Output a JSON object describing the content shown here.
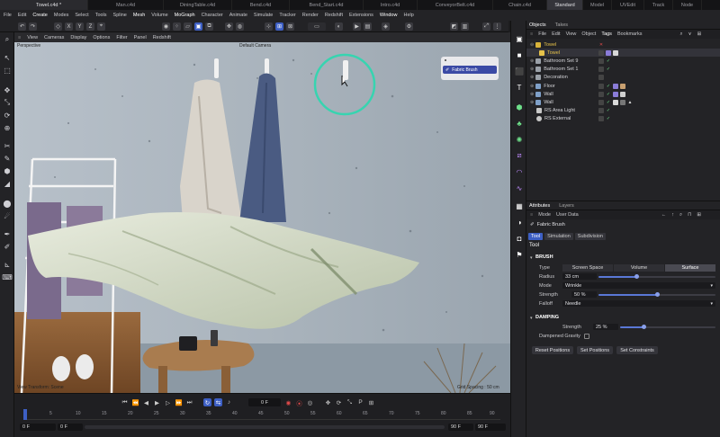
{
  "tabs": [
    {
      "label": "Towel.c4d *",
      "active": true
    },
    {
      "label": "Man.c4d"
    },
    {
      "label": "DiningTable.c4d"
    },
    {
      "label": "Bend.c4d"
    },
    {
      "label": "Bend_Start.c4d"
    },
    {
      "label": "Intro.c4d"
    },
    {
      "label": "ConveyorBelt.c4d"
    },
    {
      "label": "Chain.c4d"
    },
    {
      "label": "Standard",
      "active": true
    },
    {
      "label": "Model"
    },
    {
      "label": "UVEdit"
    },
    {
      "label": "Track"
    },
    {
      "label": "Node"
    }
  ],
  "menubar": [
    "File",
    "Edit",
    "Create",
    "Modes",
    "Select",
    "Tools",
    "Spline",
    "Mesh",
    "Volume",
    "MoGraph",
    "Character",
    "Animate",
    "Simulate",
    "Tracker",
    "Render",
    "Redshift",
    "Extensions",
    "Window",
    "Help"
  ],
  "viewport_menu": [
    "View",
    "Cameras",
    "Display",
    "Options",
    "Filter",
    "Panel",
    "Redshift"
  ],
  "viewport": {
    "label_perspective": "Perspective",
    "label_camera": "Default Camera",
    "footer_left": "View Transform: Scene",
    "footer_right": "Grid Spacing : 50 cm",
    "brush_popup_label": "Fabric Brush"
  },
  "timeline": {
    "current_frame": "0 F",
    "start_field": "0 F",
    "start_field2": "0 F",
    "end_field": "90 F",
    "end_field2": "90 F",
    "ruler": [
      "0",
      "5",
      "10",
      "15",
      "20",
      "25",
      "30",
      "35",
      "40",
      "45",
      "50",
      "55",
      "60",
      "65",
      "70",
      "75",
      "80",
      "85",
      "90"
    ]
  },
  "objects_panel": {
    "tabs": [
      "Objects",
      "Takes"
    ],
    "menu": [
      "File",
      "Edit",
      "View",
      "Object",
      "Tags",
      "Bookmarks"
    ],
    "rows": [
      {
        "name": "Towel",
        "indent": 0,
        "color": "#d9b33a"
      },
      {
        "name": "Towel",
        "indent": 1,
        "color": "#e6c24a",
        "selected": true
      },
      {
        "name": "Bathroom Set 9",
        "indent": 0,
        "color": "#9aa0a8"
      },
      {
        "name": "Bathroom Set 1",
        "indent": 0,
        "color": "#9aa0a8"
      },
      {
        "name": "Decoration",
        "indent": 0,
        "color": "#9aa0a8"
      },
      {
        "name": "Floor",
        "indent": 0,
        "color": "#7fa0c8"
      },
      {
        "name": "Wall",
        "indent": 0,
        "color": "#7fa0c8"
      },
      {
        "name": "Wall",
        "indent": 0,
        "color": "#7fa0c8"
      },
      {
        "name": "RS Area Light",
        "indent": 0,
        "color": "#c8c8c8"
      },
      {
        "name": "RS External",
        "indent": 0,
        "color": "#c8c8c8"
      }
    ]
  },
  "attributes_panel": {
    "tabs": [
      "Attributes",
      "Layers"
    ],
    "menu": [
      "Mode",
      "User Data"
    ],
    "object_name": "Fabric Brush",
    "subtabs": [
      "Tool",
      "Simulation",
      "Subdivision"
    ],
    "section_title": "Tool",
    "brush": {
      "header": "BRUSH",
      "type_label": "Type",
      "type_options": [
        "Screen Space",
        "Volume",
        "Surface"
      ],
      "type_selected": "Surface",
      "radius_label": "Radius",
      "radius_value": "33 cm",
      "radius_fraction": 0.33,
      "mode_label": "Mode",
      "mode_value": "Wrinkle",
      "strength_label": "Strength",
      "strength_value": "50 %",
      "strength_fraction": 0.5,
      "falloff_label": "Falloff",
      "falloff_value": "Needle"
    },
    "damping": {
      "header": "DAMPING",
      "strength_label": "Strength",
      "strength_value": "25 %",
      "strength_fraction": 0.25,
      "gravity_label": "Dampened Gravity"
    },
    "buttons": [
      "Reset Positions",
      "Set Positions",
      "Set Constraints"
    ]
  }
}
